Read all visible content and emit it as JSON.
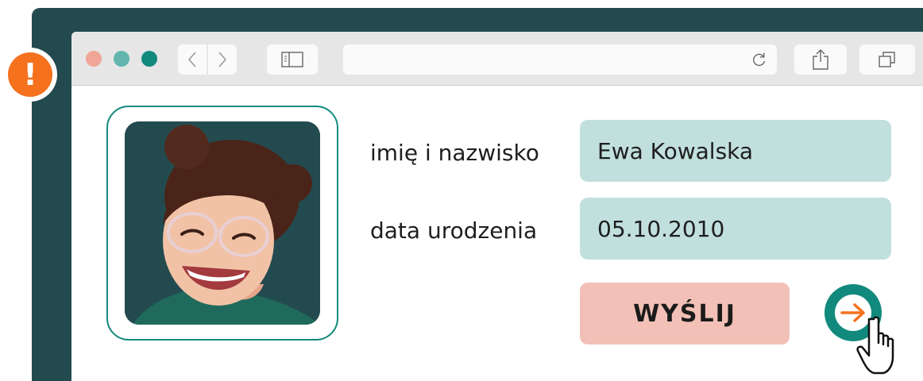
{
  "form": {
    "name_label": "imię i nazwisko",
    "name_value": "Ewa Kowalska",
    "birthdate_label": "data urodzenia",
    "birthdate_value": "05.10.2010",
    "submit_label": "WYŚLIJ"
  },
  "alert": {
    "symbol": "!"
  },
  "icons": [
    "back-arrow-icon",
    "forward-arrow-icon",
    "sidebar-icon",
    "reload-icon",
    "share-icon",
    "tabs-icon",
    "arrow-right-icon",
    "hand-pointer-icon",
    "exclamation-icon"
  ],
  "colors": {
    "frame": "#234b4f",
    "accent_teal": "#118a7d",
    "field_bg": "#c1e0dd",
    "submit_bg": "#f2c0b6",
    "alert_orange": "#f5711e",
    "traffic_red": "#f0a596",
    "traffic_green": "#61b5ad",
    "traffic_teal": "#118a7d"
  }
}
